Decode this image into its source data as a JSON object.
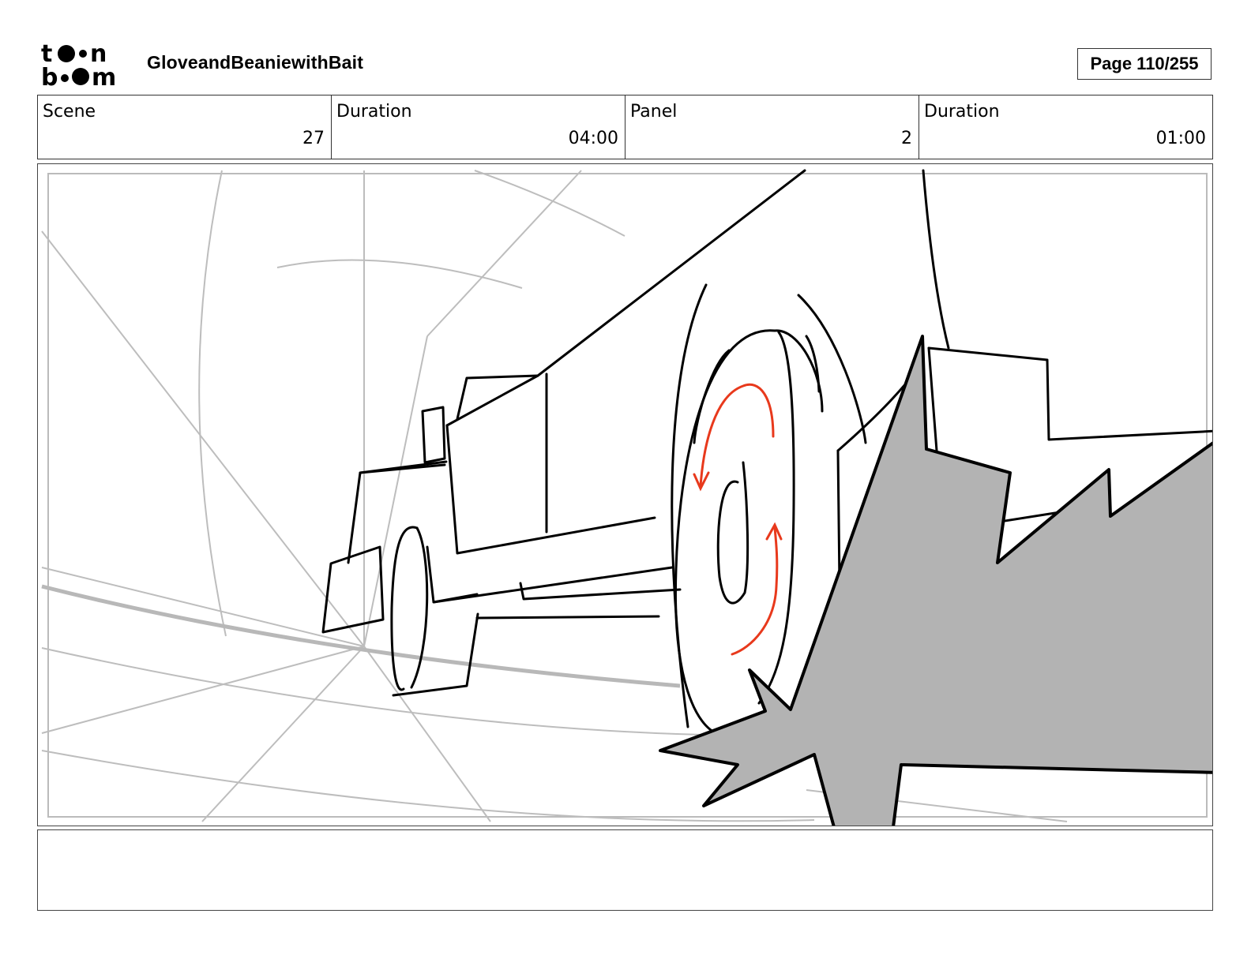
{
  "header": {
    "project_title": "GloveandBeaniewithBait",
    "page_label": "Page 110/255"
  },
  "info": [
    {
      "label": "Scene",
      "value": "27"
    },
    {
      "label": "Duration",
      "value": "04:00"
    },
    {
      "label": "Panel",
      "value": "2"
    },
    {
      "label": "Duration",
      "value": "01:00"
    }
  ],
  "notes": {
    "text": ""
  },
  "colors": {
    "guide_lines": "#bdbdbd",
    "ink": "#000000",
    "motion_arrows": "#e8391c",
    "shadow_fill": "#b3b3b3"
  }
}
